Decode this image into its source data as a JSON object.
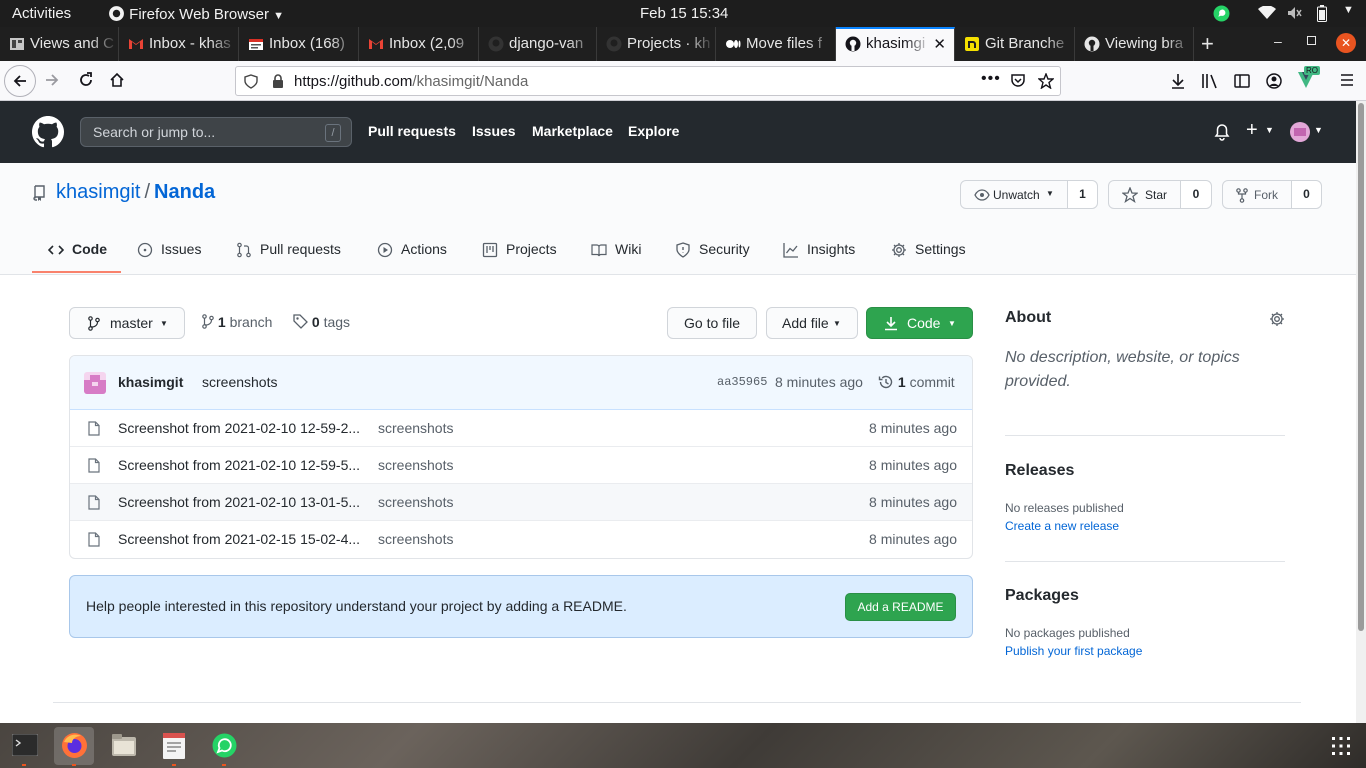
{
  "system_bar": {
    "activities": "Activities",
    "app_name": "Firefox Web Browser",
    "clock": "Feb 15  15:34"
  },
  "browser": {
    "tabs": [
      {
        "label": "Views and C",
        "icon": "views-icon"
      },
      {
        "label": "Inbox - khas",
        "icon": "gmail-icon"
      },
      {
        "label": "Inbox (168)",
        "icon": "mail-icon"
      },
      {
        "label": "Inbox (2,09",
        "icon": "gmail-icon"
      },
      {
        "label": "django-van",
        "icon": "github-icon"
      },
      {
        "label": "Projects · kh",
        "icon": "github-icon"
      },
      {
        "label": "Move files f",
        "icon": "medium-icon"
      },
      {
        "label": "khasimgi",
        "icon": "github-icon",
        "active": true
      },
      {
        "label": "Git Branche",
        "icon": "nodejs-icon"
      },
      {
        "label": "Viewing bra",
        "icon": "github-icon"
      }
    ],
    "url_host": "https://github.com",
    "url_path": "/khasimgit/Nanda",
    "extension_badge": "RO"
  },
  "github_header": {
    "search_placeholder": "Search or jump to...",
    "search_shortcut": "/",
    "nav": [
      "Pull requests",
      "Issues",
      "Marketplace",
      "Explore"
    ]
  },
  "repo": {
    "owner": "khasimgit",
    "separator": "/",
    "name": "Nanda",
    "watch_label": "Unwatch",
    "watch_count": "1",
    "star_label": "Star",
    "star_count": "0",
    "fork_label": "Fork",
    "fork_count": "0",
    "tabs": [
      "Code",
      "Issues",
      "Pull requests",
      "Actions",
      "Projects",
      "Wiki",
      "Security",
      "Insights",
      "Settings"
    ]
  },
  "code_view": {
    "branch": "master",
    "branch_count": "1",
    "branch_label": "branch",
    "tag_count": "0",
    "tag_label": "tags",
    "go_to_file": "Go to file",
    "add_file": "Add file",
    "code_button": "Code",
    "latest_commit": {
      "author": "khasimgit",
      "message": "screenshots",
      "sha": "aa35965",
      "age": "8 minutes ago",
      "commit_count": "1",
      "commit_label": "commit"
    },
    "files": [
      {
        "name": "Screenshot from 2021-02-10 12-59-2...",
        "message": "screenshots",
        "age": "8 minutes ago"
      },
      {
        "name": "Screenshot from 2021-02-10 12-59-5...",
        "message": "screenshots",
        "age": "8 minutes ago"
      },
      {
        "name": "Screenshot from 2021-02-10 13-01-5...",
        "message": "screenshots",
        "age": "8 minutes ago"
      },
      {
        "name": "Screenshot from 2021-02-15 15-02-4...",
        "message": "screenshots",
        "age": "8 minutes ago"
      }
    ],
    "readme_prompt": "Help people interested in this repository understand your project by adding a README.",
    "readme_button": "Add a README"
  },
  "sidebar": {
    "about_title": "About",
    "about_text": "No description, website, or topics provided.",
    "releases_title": "Releases",
    "releases_text": "No releases published",
    "releases_link": "Create a new release",
    "packages_title": "Packages",
    "packages_text": "No packages published",
    "packages_link": "Publish your first package"
  },
  "colors": {
    "gh_header": "#24292e",
    "link": "#0366d6",
    "primary_button": "#2ea44f",
    "active_tab_underline": "#f9826c",
    "firefox_active_tab": "#0a84ff"
  }
}
